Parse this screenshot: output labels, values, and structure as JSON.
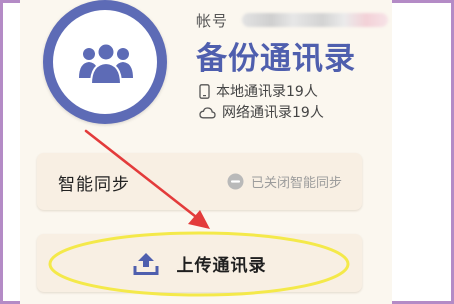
{
  "header": {
    "account_label": "帐号",
    "title": "备份通讯录"
  },
  "counts": {
    "local": "本地通讯录19人",
    "cloud": "网络通讯录19人"
  },
  "sync": {
    "label": "智能同步",
    "status": "已关闭智能同步"
  },
  "upload": {
    "label": "上传通讯录"
  },
  "colors": {
    "brand": "#5d6bb6",
    "title": "#4f5fae",
    "annotation_arrow": "#e33b3b",
    "annotation_ellipse": "#f4e94a",
    "card_bg": "#f8efe3"
  },
  "icons": {
    "avatar": "contacts-group-icon",
    "local": "phone-icon",
    "cloud": "cloud-icon",
    "sync_status": "minus-circle-icon",
    "upload": "upload-icon"
  }
}
